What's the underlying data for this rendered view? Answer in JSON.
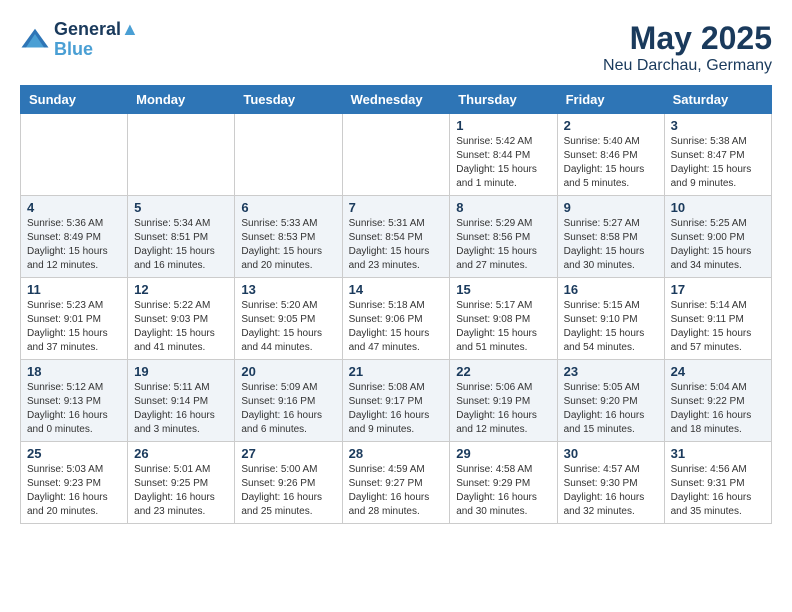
{
  "header": {
    "logo_line1": "General",
    "logo_line2": "Blue",
    "title": "May 2025",
    "subtitle": "Neu Darchau, Germany"
  },
  "calendar": {
    "weekdays": [
      "Sunday",
      "Monday",
      "Tuesday",
      "Wednesday",
      "Thursday",
      "Friday",
      "Saturday"
    ],
    "weeks": [
      [
        {
          "day": "",
          "info": ""
        },
        {
          "day": "",
          "info": ""
        },
        {
          "day": "",
          "info": ""
        },
        {
          "day": "",
          "info": ""
        },
        {
          "day": "1",
          "info": "Sunrise: 5:42 AM\nSunset: 8:44 PM\nDaylight: 15 hours\nand 1 minute."
        },
        {
          "day": "2",
          "info": "Sunrise: 5:40 AM\nSunset: 8:46 PM\nDaylight: 15 hours\nand 5 minutes."
        },
        {
          "day": "3",
          "info": "Sunrise: 5:38 AM\nSunset: 8:47 PM\nDaylight: 15 hours\nand 9 minutes."
        }
      ],
      [
        {
          "day": "4",
          "info": "Sunrise: 5:36 AM\nSunset: 8:49 PM\nDaylight: 15 hours\nand 12 minutes."
        },
        {
          "day": "5",
          "info": "Sunrise: 5:34 AM\nSunset: 8:51 PM\nDaylight: 15 hours\nand 16 minutes."
        },
        {
          "day": "6",
          "info": "Sunrise: 5:33 AM\nSunset: 8:53 PM\nDaylight: 15 hours\nand 20 minutes."
        },
        {
          "day": "7",
          "info": "Sunrise: 5:31 AM\nSunset: 8:54 PM\nDaylight: 15 hours\nand 23 minutes."
        },
        {
          "day": "8",
          "info": "Sunrise: 5:29 AM\nSunset: 8:56 PM\nDaylight: 15 hours\nand 27 minutes."
        },
        {
          "day": "9",
          "info": "Sunrise: 5:27 AM\nSunset: 8:58 PM\nDaylight: 15 hours\nand 30 minutes."
        },
        {
          "day": "10",
          "info": "Sunrise: 5:25 AM\nSunset: 9:00 PM\nDaylight: 15 hours\nand 34 minutes."
        }
      ],
      [
        {
          "day": "11",
          "info": "Sunrise: 5:23 AM\nSunset: 9:01 PM\nDaylight: 15 hours\nand 37 minutes."
        },
        {
          "day": "12",
          "info": "Sunrise: 5:22 AM\nSunset: 9:03 PM\nDaylight: 15 hours\nand 41 minutes."
        },
        {
          "day": "13",
          "info": "Sunrise: 5:20 AM\nSunset: 9:05 PM\nDaylight: 15 hours\nand 44 minutes."
        },
        {
          "day": "14",
          "info": "Sunrise: 5:18 AM\nSunset: 9:06 PM\nDaylight: 15 hours\nand 47 minutes."
        },
        {
          "day": "15",
          "info": "Sunrise: 5:17 AM\nSunset: 9:08 PM\nDaylight: 15 hours\nand 51 minutes."
        },
        {
          "day": "16",
          "info": "Sunrise: 5:15 AM\nSunset: 9:10 PM\nDaylight: 15 hours\nand 54 minutes."
        },
        {
          "day": "17",
          "info": "Sunrise: 5:14 AM\nSunset: 9:11 PM\nDaylight: 15 hours\nand 57 minutes."
        }
      ],
      [
        {
          "day": "18",
          "info": "Sunrise: 5:12 AM\nSunset: 9:13 PM\nDaylight: 16 hours\nand 0 minutes."
        },
        {
          "day": "19",
          "info": "Sunrise: 5:11 AM\nSunset: 9:14 PM\nDaylight: 16 hours\nand 3 minutes."
        },
        {
          "day": "20",
          "info": "Sunrise: 5:09 AM\nSunset: 9:16 PM\nDaylight: 16 hours\nand 6 minutes."
        },
        {
          "day": "21",
          "info": "Sunrise: 5:08 AM\nSunset: 9:17 PM\nDaylight: 16 hours\nand 9 minutes."
        },
        {
          "day": "22",
          "info": "Sunrise: 5:06 AM\nSunset: 9:19 PM\nDaylight: 16 hours\nand 12 minutes."
        },
        {
          "day": "23",
          "info": "Sunrise: 5:05 AM\nSunset: 9:20 PM\nDaylight: 16 hours\nand 15 minutes."
        },
        {
          "day": "24",
          "info": "Sunrise: 5:04 AM\nSunset: 9:22 PM\nDaylight: 16 hours\nand 18 minutes."
        }
      ],
      [
        {
          "day": "25",
          "info": "Sunrise: 5:03 AM\nSunset: 9:23 PM\nDaylight: 16 hours\nand 20 minutes."
        },
        {
          "day": "26",
          "info": "Sunrise: 5:01 AM\nSunset: 9:25 PM\nDaylight: 16 hours\nand 23 minutes."
        },
        {
          "day": "27",
          "info": "Sunrise: 5:00 AM\nSunset: 9:26 PM\nDaylight: 16 hours\nand 25 minutes."
        },
        {
          "day": "28",
          "info": "Sunrise: 4:59 AM\nSunset: 9:27 PM\nDaylight: 16 hours\nand 28 minutes."
        },
        {
          "day": "29",
          "info": "Sunrise: 4:58 AM\nSunset: 9:29 PM\nDaylight: 16 hours\nand 30 minutes."
        },
        {
          "day": "30",
          "info": "Sunrise: 4:57 AM\nSunset: 9:30 PM\nDaylight: 16 hours\nand 32 minutes."
        },
        {
          "day": "31",
          "info": "Sunrise: 4:56 AM\nSunset: 9:31 PM\nDaylight: 16 hours\nand 35 minutes."
        }
      ]
    ]
  }
}
